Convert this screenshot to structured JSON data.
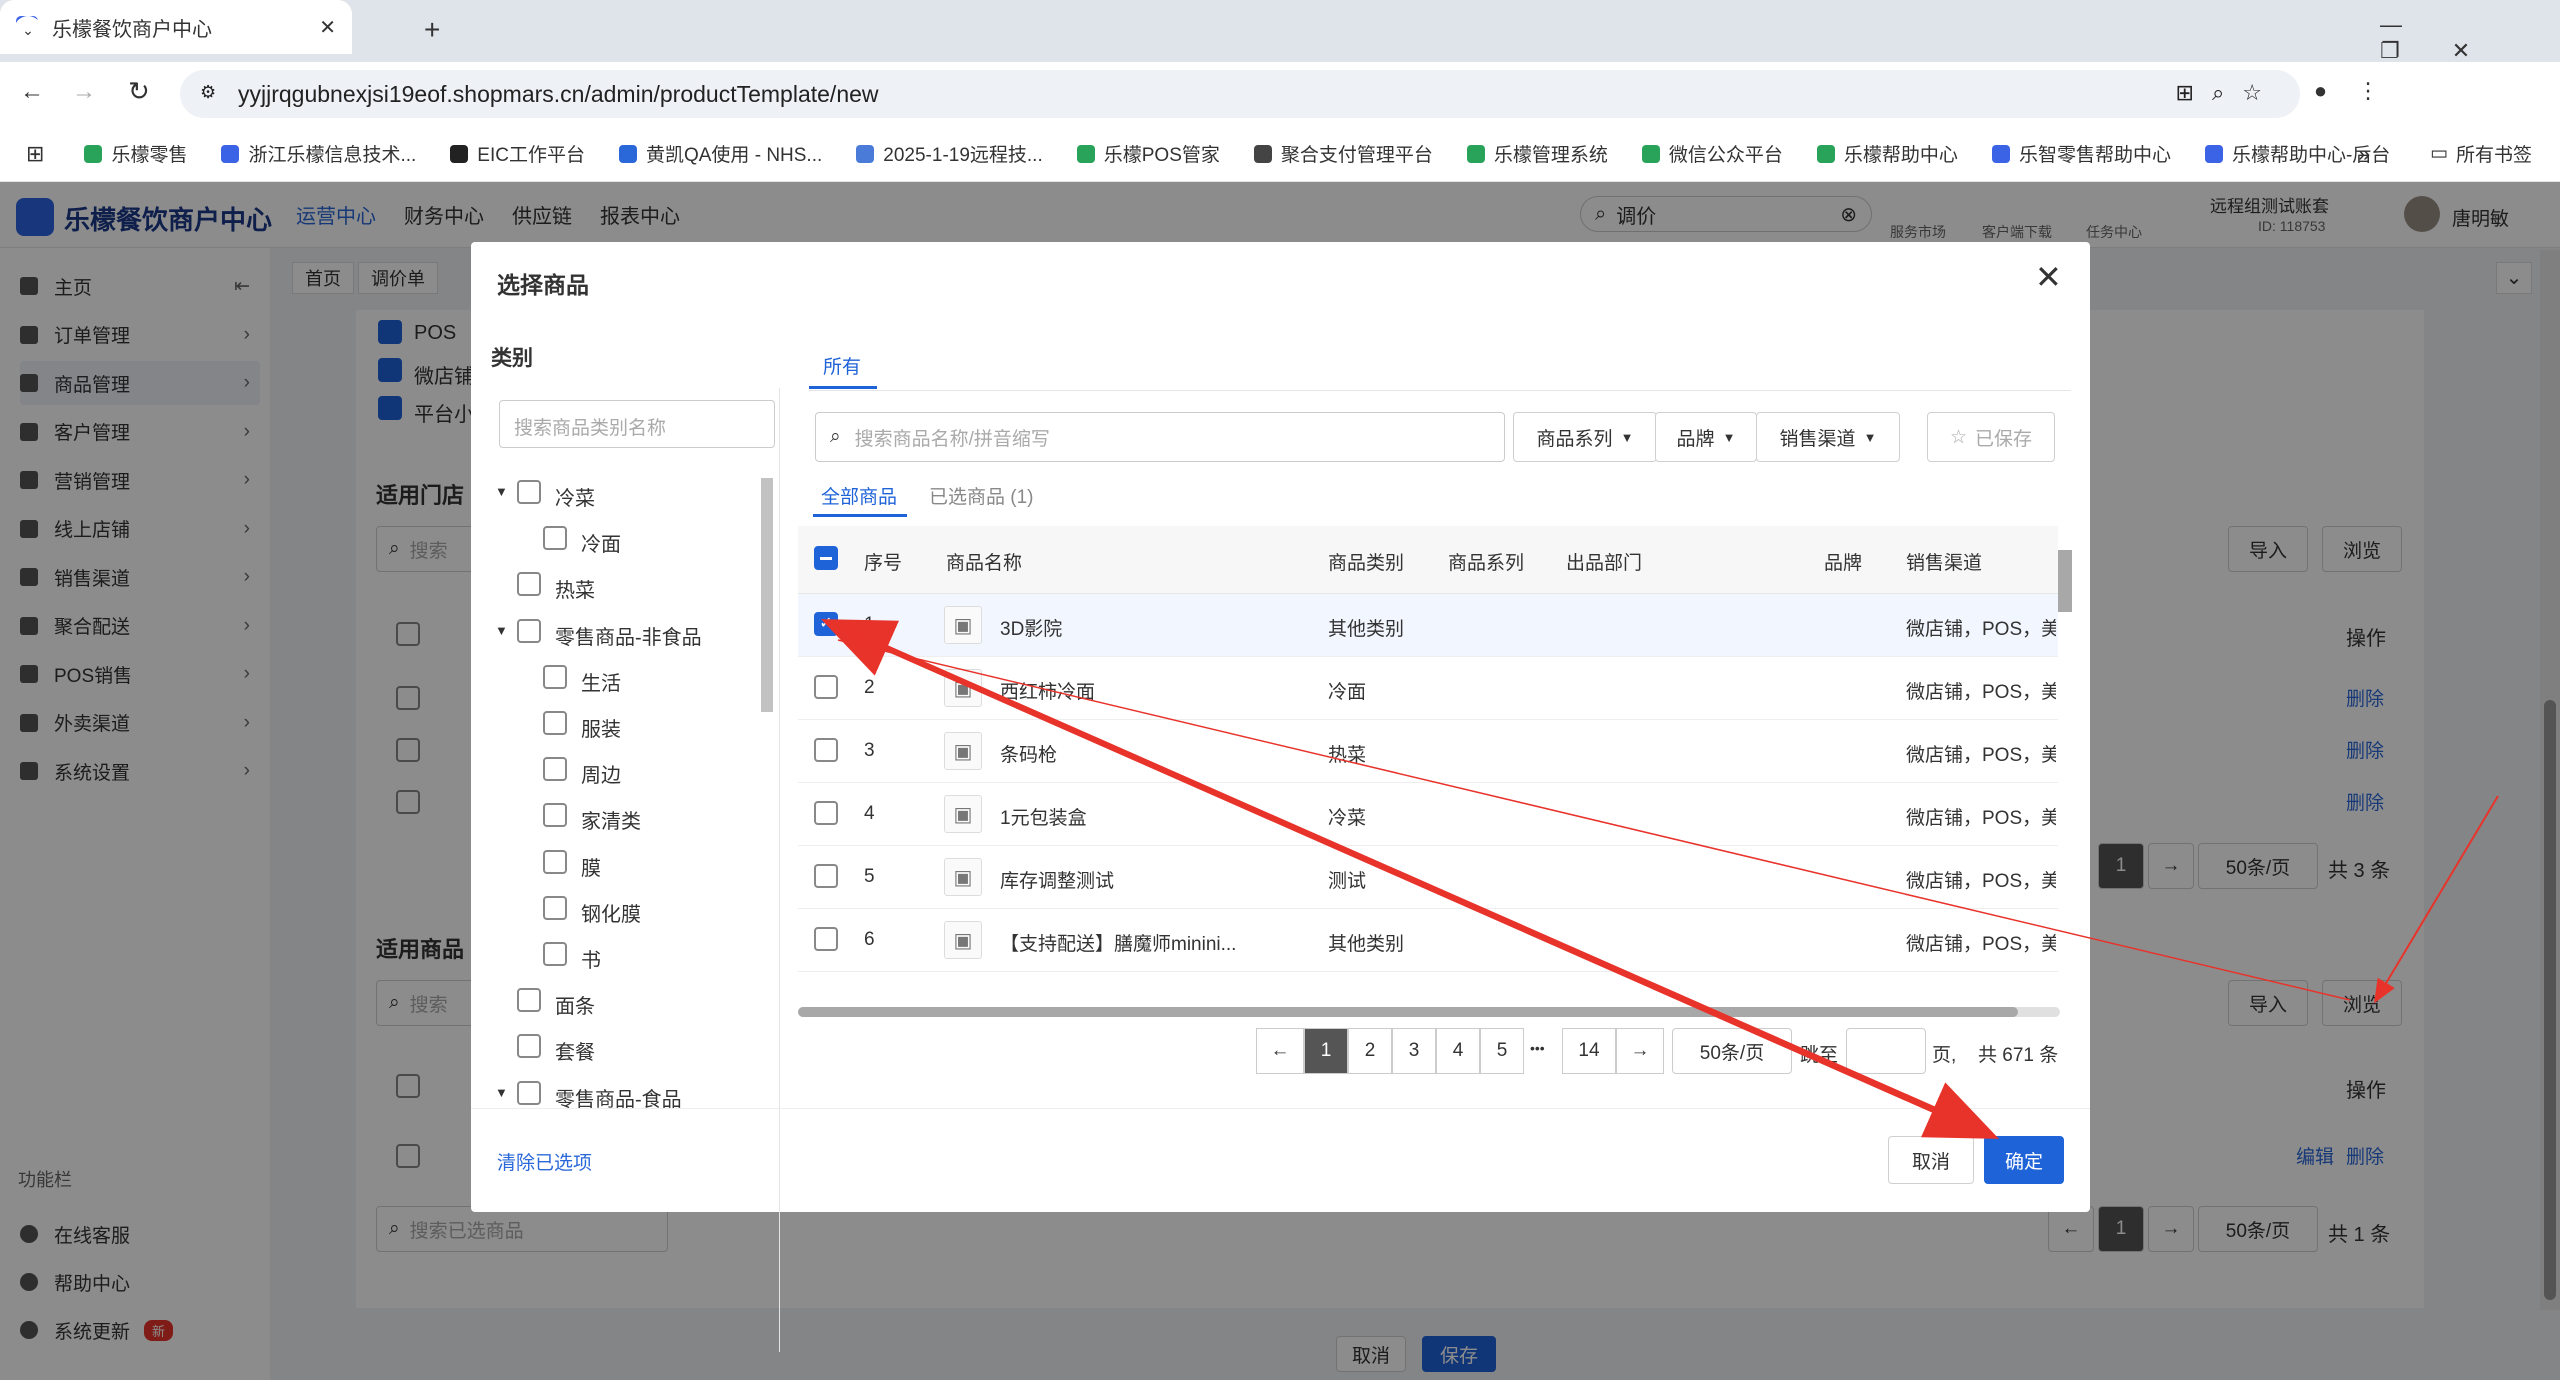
{
  "browser": {
    "tab_title": "乐檬餐饮商户中心",
    "url": "yyjjrqgubnexjsi19eof.shopmars.cn/admin/productTemplate/new",
    "bookmarks": [
      "乐檬零售",
      "浙江乐檬信息技术...",
      "EIC工作平台",
      "黄凯QA使用 - NHS...",
      "2025-1-19远程技...",
      "乐檬POS管家",
      "聚合支付管理平台",
      "乐檬管理系统",
      "微信公众平台",
      "乐檬帮助中心",
      "乐智零售帮助中心",
      "乐檬帮助中心-后台"
    ],
    "all_bookmarks": "所有书签"
  },
  "app": {
    "logo": "乐檬餐饮商户中心",
    "nav": [
      "运营中心",
      "财务中心",
      "供应链",
      "报表中心"
    ],
    "search_value": "调价",
    "tools": [
      "服务市场",
      "客户端下载",
      "任务中心"
    ],
    "account": "远程组测试账套",
    "account_id": "ID: 118753",
    "user": "唐明敏"
  },
  "sidebar": {
    "items": [
      "主页",
      "订单管理",
      "商品管理",
      "客户管理",
      "营销管理",
      "线上店铺",
      "销售渠道",
      "聚合配送",
      "POS销售",
      "外卖渠道",
      "系统设置"
    ],
    "section": "功能栏",
    "bottom": [
      "在线客服",
      "帮助中心",
      "系统更新"
    ],
    "new_badge": "新"
  },
  "page": {
    "breadcrumbs": [
      "首页",
      "调价单"
    ],
    "channels": [
      "POS",
      "微店铺",
      "平台小"
    ],
    "store_title": "适用门店",
    "product_title": "适用商品",
    "search_short": "搜索",
    "search_selected": "搜索已选商品",
    "import": "导入",
    "browse": "浏览",
    "op": "操作",
    "delete": "删除",
    "edit": "编辑",
    "page_one": "1",
    "per_page": "50条/页",
    "total_store": "共 3 条",
    "total_product": "共 1 条",
    "cancel": "取消",
    "save": "保存"
  },
  "dialog": {
    "title": "选择商品",
    "category_title": "类别",
    "category_search_placeholder": "搜索商品类别名称",
    "categories": [
      {
        "label": "冷菜",
        "level": 0,
        "expanded": true
      },
      {
        "label": "冷面",
        "level": 1
      },
      {
        "label": "热菜",
        "level": 0
      },
      {
        "label": "零售商品-非食品",
        "level": 0,
        "expanded": true
      },
      {
        "label": "生活",
        "level": 1
      },
      {
        "label": "服装",
        "level": 1
      },
      {
        "label": "周边",
        "level": 1
      },
      {
        "label": "家清类",
        "level": 1
      },
      {
        "label": "膜",
        "level": 1
      },
      {
        "label": "钢化膜",
        "level": 1
      },
      {
        "label": "书",
        "level": 1
      },
      {
        "label": "面条",
        "level": 0
      },
      {
        "label": "套餐",
        "level": 0
      },
      {
        "label": "零售商品-食品",
        "level": 0,
        "expanded": true
      }
    ],
    "clear_selected": "清除已选项",
    "top_tab": "所有",
    "product_search_placeholder": "搜索商品名称/拼音缩写",
    "filters": [
      "商品系列",
      "品牌",
      "销售渠道"
    ],
    "saved": "已保存",
    "sub_tabs": [
      "全部商品",
      "已选商品 (1)"
    ],
    "columns": [
      "序号",
      "商品名称",
      "商品类别",
      "商品系列",
      "出品部门",
      "品牌",
      "销售渠道"
    ],
    "rows": [
      {
        "no": "1",
        "name": "3D影院",
        "category": "其他类别",
        "channel": "微店铺，POS，美",
        "checked": true
      },
      {
        "no": "2",
        "name": "西红柿冷面",
        "category": "冷面",
        "channel": "微店铺，POS，美",
        "checked": false
      },
      {
        "no": "3",
        "name": "条码枪",
        "category": "热菜",
        "channel": "微店铺，POS，美",
        "checked": false
      },
      {
        "no": "4",
        "name": "1元包装盒",
        "category": "冷菜",
        "channel": "微店铺，POS，美",
        "checked": false
      },
      {
        "no": "5",
        "name": "库存调整测试",
        "category": "测试",
        "channel": "微店铺，POS，美",
        "checked": false
      },
      {
        "no": "6",
        "name": "【支持配送】膳魔师minini...",
        "category": "其他类别",
        "channel": "微店铺，POS，美",
        "checked": false
      }
    ],
    "pagination": [
      "1",
      "2",
      "3",
      "4",
      "5",
      "14"
    ],
    "ellipsis": "•••",
    "per_page": "50条/页",
    "jump_label": "跳至",
    "page_unit": "页,",
    "total": "共 671 条",
    "cancel": "取消",
    "confirm": "确定"
  },
  "colors": {
    "primary": "#1f63d9",
    "annotation": "#e8332b"
  }
}
